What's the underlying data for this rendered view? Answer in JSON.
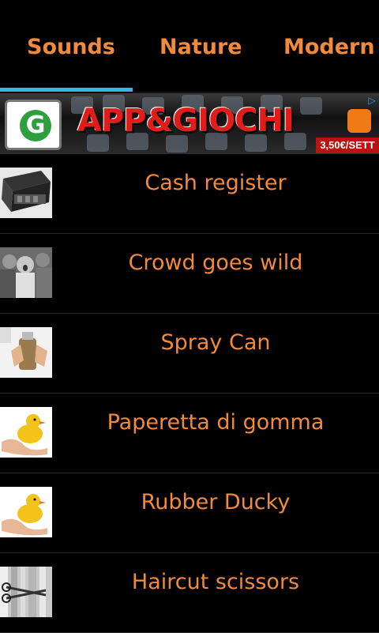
{
  "tabs": [
    {
      "label": "Sounds",
      "selected": true
    },
    {
      "label": "Nature",
      "selected": false
    },
    {
      "label": "Modern",
      "selected": false
    }
  ],
  "ad": {
    "logo_letter": "G",
    "title": "APP&GIOCHI",
    "price": "3,50€/SETT",
    "info_icon": "info-icon"
  },
  "sounds": [
    {
      "label": "Cash register",
      "icon": "cash-register-image"
    },
    {
      "label": "Crowd goes wild",
      "icon": "crowd-image"
    },
    {
      "label": "Spray Can",
      "icon": "spray-can-image"
    },
    {
      "label": "Paperetta di gomma",
      "icon": "rubber-duck-image"
    },
    {
      "label": "Rubber Ducky",
      "icon": "rubber-duck-image"
    },
    {
      "label": "Haircut scissors",
      "icon": "scissors-image"
    }
  ],
  "colors": {
    "accent": "#f28a3c",
    "tab_indicator": "#33b5e5",
    "background": "#000000"
  }
}
